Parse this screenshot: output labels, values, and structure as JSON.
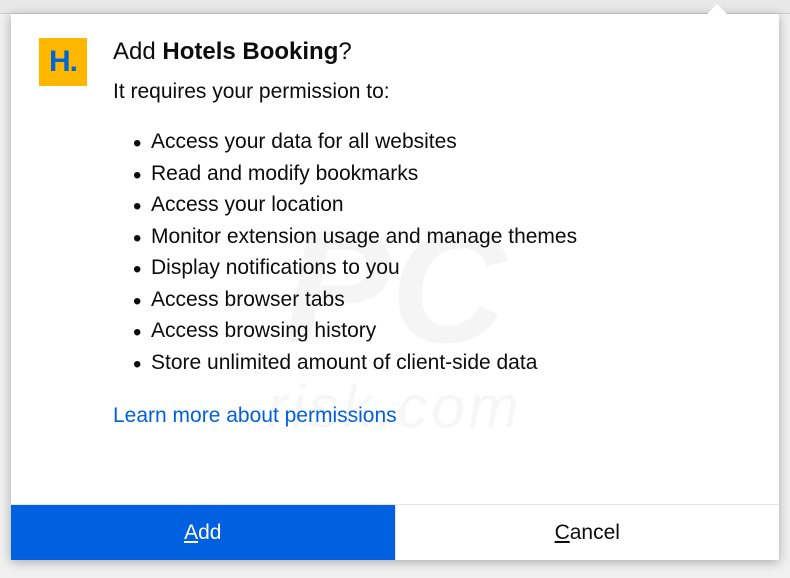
{
  "extension": {
    "name": "Hotels Booking",
    "icon_letter": "H."
  },
  "dialog": {
    "title_prefix": "Add ",
    "title_suffix": "?",
    "subtitle": "It requires your permission to:",
    "permissions": [
      "Access your data for all websites",
      "Read and modify bookmarks",
      "Access your location",
      "Monitor extension usage and manage themes",
      "Display notifications to you",
      "Access browser tabs",
      "Access browsing history",
      "Store unlimited amount of client-side data"
    ],
    "learn_more": "Learn more about permissions",
    "add_btn_acc": "A",
    "add_btn_rest": "dd",
    "cancel_btn_acc": "C",
    "cancel_btn_rest": "ancel"
  }
}
